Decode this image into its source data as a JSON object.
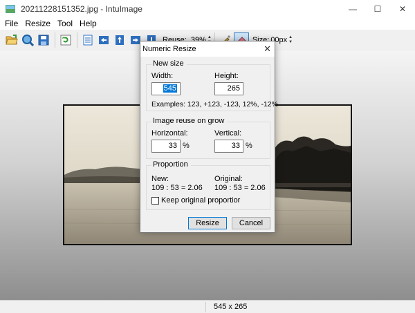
{
  "window": {
    "title": "20211228151352.jpg - IntuImage",
    "minimize_glyph": "—",
    "maximize_glyph": "☐",
    "close_glyph": "✕"
  },
  "menu": {
    "items": [
      "File",
      "Resize",
      "Tool",
      "Help"
    ]
  },
  "toolbar": {
    "icons": [
      "open-folder-icon",
      "zoom-icon",
      "save-icon",
      "refresh-icon",
      "page-icon",
      "arrow-left-icon",
      "arrow-up-icon",
      "arrow-right-icon",
      "arrow-down-icon",
      "paint-icon",
      "eraser-icon"
    ],
    "reuse_label": "Reuse:",
    "reuse_value": "39%",
    "size_label": "Size:",
    "size_value": "00px"
  },
  "status": {
    "dimensions": "545 x 265"
  },
  "dialog": {
    "title": "Numeric Resize",
    "new_size": {
      "group_title": "New size",
      "width_label": "Width:",
      "width_value": "545",
      "height_label": "Height:",
      "height_value": "265",
      "examples": "Examples:  123, +123, -123, 12%, -12%"
    },
    "reuse": {
      "group_title": "Image reuse on grow",
      "horizontal_label": "Horizontal:",
      "horizontal_value": "33",
      "vertical_label": "Vertical:",
      "vertical_value": "33",
      "percent": "%"
    },
    "proportion": {
      "group_title": "Proportion",
      "new_label": "New:",
      "new_value": "109 : 53 = 2.06",
      "original_label": "Original:",
      "original_value": "109 : 53 = 2.06",
      "keep_label": "Keep original proportior",
      "keep_checked": false
    },
    "resize_button": "Resize",
    "cancel_button": "Cancel"
  }
}
